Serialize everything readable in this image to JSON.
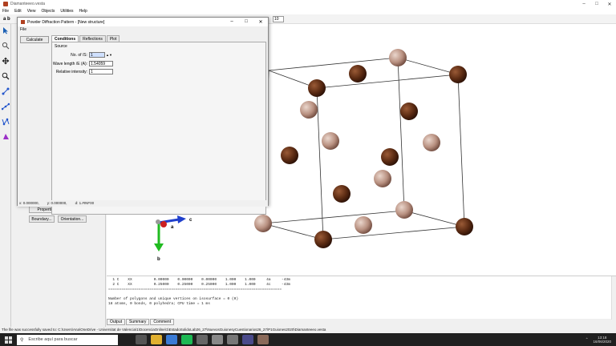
{
  "app": {
    "title": "Diamanteeeo.vesta",
    "menu": [
      "File",
      "Edit",
      "View",
      "Objects",
      "Utilities",
      "Help"
    ],
    "toolbar_text": "a b",
    "toolbar_value": "10"
  },
  "sidepanel": {
    "buttons": [
      "Properties...",
      "Boundary...",
      "Orientation..."
    ]
  },
  "axes": {
    "a": "a",
    "b": "b",
    "c": "c"
  },
  "dialog": {
    "title": "Powder Diffraction Pattern - [New structure]",
    "menu": "File",
    "calculate_label": "Calculate",
    "tabs": [
      "Conditions",
      "Reflections",
      "Plot"
    ],
    "active_tab": "Conditions",
    "source_label": "Source",
    "fields": {
      "no_of_label": "No. of /S:",
      "no_of_value": "1",
      "wavelength_label": "Wave length /E (A):",
      "wavelength_value": "1.54059",
      "intensity_label": "Relative intensity:",
      "intensity_value": "1"
    },
    "coords": {
      "x": "x: 0.000000,",
      "y": "y: 0.000000,",
      "d": "d: 1.#INF00"
    }
  },
  "output": {
    "lines": [
      "  1 C    XX          0.00000    0.00000    0.00000    1.000    1.000     4a     -43m",
      "  2 C    XX          0.25000    0.25000    0.25000    1.000    1.000     4c     -43m",
      "================================================================================",
      "",
      "Number of polygons and unique vertices on isosurface = 0 (0)",
      "18 atoms, 0 bonds, 0 polyhedra; CPU time = 1 ms"
    ],
    "tabs": [
      "Output",
      "Summary",
      "Comment"
    ]
  },
  "status_text": "The file was successfully saved to: C:\\Users\\Ana\\OneDrive - Universitat de Valencia\\1\\DocenciaOnline\\1\\EstadoSolidoLab26_27\\NuevosGuionesyCuestionarios26_27\\P1Guiones2020\\Diamanteeeo.vesta",
  "taskbar": {
    "search_placeholder": "Escribe aquí para buscar",
    "time": "13:18",
    "date": "16/06/2020"
  },
  "colors": {
    "atom_dark": "#5a2a12",
    "atom_light": "#b89080",
    "axis_a": "#cc2020",
    "axis_b": "#20bb20",
    "axis_c": "#2040cc"
  }
}
